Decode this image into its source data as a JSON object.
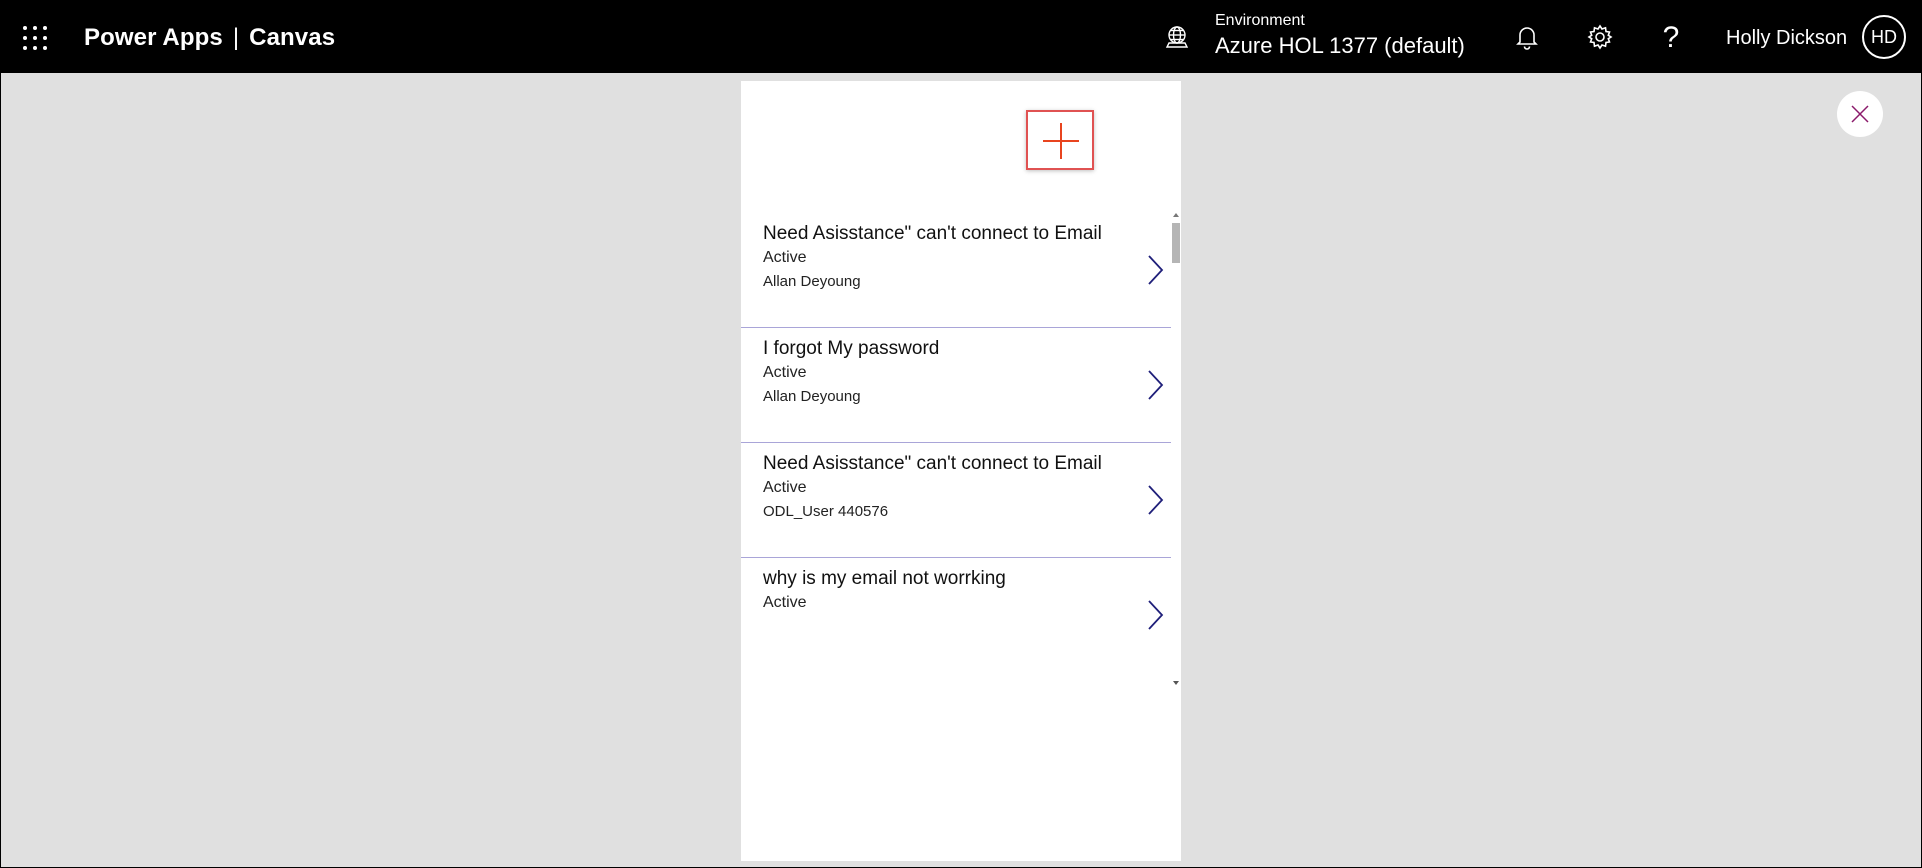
{
  "header": {
    "app_name": "Power Apps",
    "separator": "|",
    "section": "Canvas",
    "waffle_icon": "waffle-icon",
    "environment_label": "Environment",
    "environment_name": "Azure HOL 1377 (default)",
    "environment_icon": "globe-icon",
    "notifications_icon": "bell-icon",
    "settings_icon": "gear-icon",
    "help_glyph": "?",
    "user_name": "Holly Dickson",
    "user_initials": "HD"
  },
  "close_icon": "close-icon",
  "app": {
    "add_icon": "plus-icon",
    "accent_color": "#e8441f",
    "items": [
      {
        "title": "Need Asisstance\" can't connect to Email",
        "status": "Active",
        "owner": "Allan Deyoung"
      },
      {
        "title": "I forgot My password",
        "status": "Active",
        "owner": "Allan Deyoung"
      },
      {
        "title": "Need Asisstance\" can't connect to Email",
        "status": "Active",
        "owner": "ODL_User 440576"
      },
      {
        "title": "why is my email not worrking",
        "status": "Active",
        "owner": ""
      }
    ]
  },
  "colors": {
    "header_bg": "#000000",
    "page_bg": "#e0e0e0",
    "chevron": "#1f1f7a",
    "divider": "#a9a5d8",
    "highlight_border": "#e05252",
    "close_x": "#8b1a6b"
  }
}
